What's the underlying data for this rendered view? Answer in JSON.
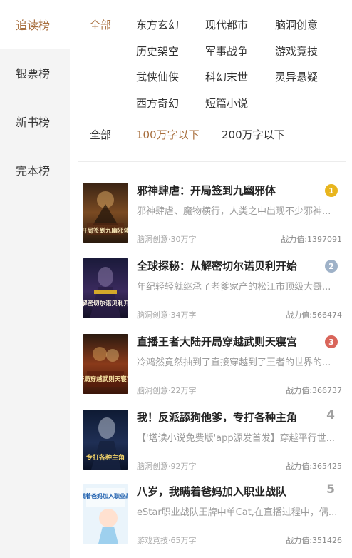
{
  "sidebar": {
    "items": [
      {
        "label": "追读榜"
      },
      {
        "label": "银票榜"
      },
      {
        "label": "新书榜"
      },
      {
        "label": "完本榜"
      }
    ]
  },
  "filters": {
    "categories": [
      "全部",
      "东方玄幻",
      "现代都市",
      "脑洞创意",
      "历史架空",
      "军事战争",
      "游戏竞技",
      "武侠仙侠",
      "科幻末世",
      "灵异悬疑",
      "西方奇幻",
      "短篇小说"
    ],
    "selected_category": "全部",
    "word_counts": [
      "全部",
      "100万字以下",
      "200万字以下"
    ],
    "selected_word_count": "100万字以下"
  },
  "colors": {
    "accent": "#a86f3e",
    "gold": "#e8b51e",
    "silver": "#9fb2c8",
    "bronze": "#d9655a"
  },
  "books": [
    {
      "rank": "1",
      "medal": "gold",
      "cover_text": "开局签到九幽邪体",
      "title": "邪神肆虐：开局签到九幽邪体",
      "desc": "邪神肆虐、魔物横行，人类之中出现不少邪神...",
      "meta": "脑洞创意·30万字",
      "score": "战力值:1397091"
    },
    {
      "rank": "2",
      "medal": "silver",
      "cover_text": "从解密切尔诺贝利开始",
      "title": "全球探秘：从解密切尔诺贝利开始",
      "desc": "年纪轻轻就继承了老爹家产的松江市顶级大哥...",
      "meta": "脑洞创意·34万字",
      "score": "战力值:566474"
    },
    {
      "rank": "3",
      "medal": "bronze",
      "cover_text": "开局穿越武则天寝宫",
      "title": "直播王者大陆开局穿越武则天寝宫",
      "desc": "冷鸿然竟然抽到了直接穿越到了王者的世界的...",
      "meta": "脑洞创意·22万字",
      "score": "战力值:366737"
    },
    {
      "rank": "4",
      "medal": "",
      "cover_text": "专打各种主角",
      "title": "我！反派舔狗他爹，专打各种主角",
      "desc": "【'塔读小说免费版'app源发首发】穿越平行世...",
      "meta": "脑洞创意·92万字",
      "score": "战力值:365425"
    },
    {
      "rank": "5",
      "medal": "",
      "cover_text": "我瞒着爸妈加入职业战队",
      "title": "八岁，我瞒着爸妈加入职业战队",
      "desc": "eStar职业战队王牌中单Cat,在直播过程中，偶...",
      "meta": "游戏竞技·65万字",
      "score": "战力值:351426"
    }
  ]
}
